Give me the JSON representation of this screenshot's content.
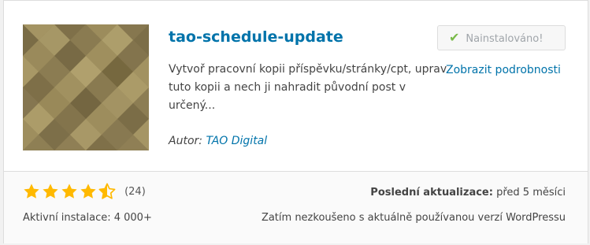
{
  "plugin": {
    "name": "tao-schedule-update",
    "description": "Vytvoř pracovní kopii příspěvku/stránky/cpt, uprav tuto kopii a nech ji nahradit původní post v určený...",
    "author_label": "Autor:",
    "author_name": "TAO Digital",
    "icon": "geometric-pattern-icon"
  },
  "actions": {
    "installed_label": "Nainstalováno!",
    "installed_icon": "checkmark-icon",
    "details_label": "Zobrazit podrobnosti"
  },
  "stats": {
    "rating": 4.5,
    "rating_max": 5,
    "rating_count_label": "(24)",
    "active_installs": "Aktivní instalace: 4 000+",
    "last_updated_label": "Poslední aktualizace:",
    "last_updated_value": "před 5 měsíci",
    "compatibility": "Zatím nezkoušeno s aktuálně používanou verzí WordPressu"
  },
  "colors": {
    "link": "#0073aa",
    "star": "#ffb900",
    "check": "#79ba49",
    "icon_base": "#8f7f55"
  }
}
